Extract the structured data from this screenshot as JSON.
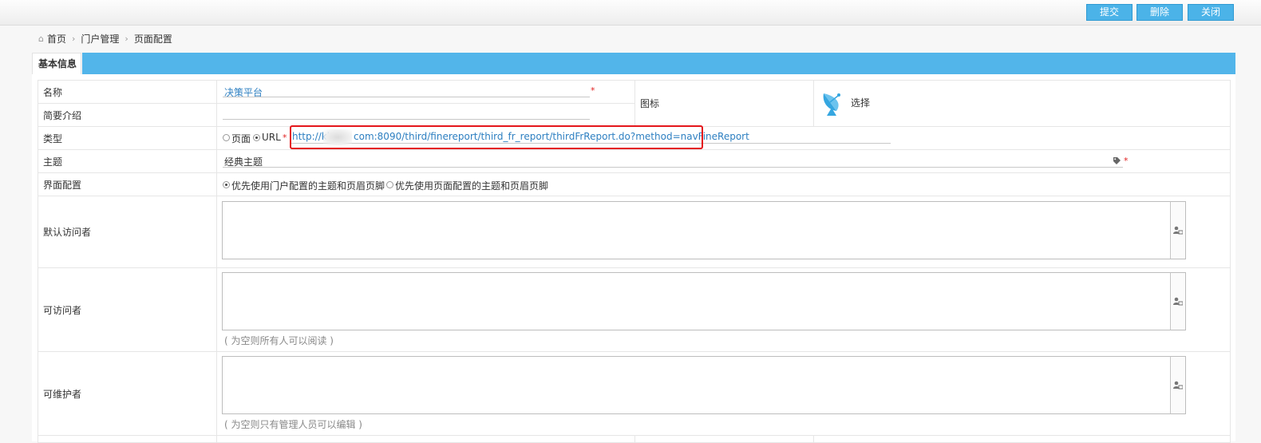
{
  "toolbar": {
    "submit_label": "提交",
    "delete_label": "删除",
    "close_label": "关闭"
  },
  "breadcrumb": {
    "home_icon": "home-icon",
    "items": [
      "首页",
      "门户管理",
      "页面配置"
    ],
    "separator": "›"
  },
  "section": {
    "title": "基本信息",
    "accent_color": "#52b5ea"
  },
  "form": {
    "name": {
      "label": "名称",
      "value": "决策平台"
    },
    "summary": {
      "label": "简要介绍",
      "value": ""
    },
    "icon": {
      "label": "图标",
      "select_label": "选择",
      "icon_name": "satellite-dish-icon"
    },
    "type": {
      "label": "类型",
      "options": [
        "页面",
        "URL"
      ],
      "selected": "URL",
      "url_prefix": "http://kk",
      "url_suffix": "com:8090/third/finereport/third_fr_report/thirdFrReport.do?method=navFineReport"
    },
    "theme": {
      "label": "主题",
      "value": "经典主题",
      "tag_icon": "tag-icon"
    },
    "ui_config": {
      "label": "界面配置",
      "options": [
        "优先使用门户配置的主题和页眉页脚",
        "优先使用页面配置的主题和页眉页脚"
      ],
      "selected": "优先使用门户配置的主题和页眉页脚"
    },
    "default_visitors": {
      "label": "默认访问者",
      "value": ""
    },
    "visitors": {
      "label": "可访问者",
      "value": "",
      "hint": "( 为空则所有人可以阅读 )"
    },
    "maintainers": {
      "label": "可维护者",
      "value": "",
      "hint": "( 为空则只有管理人员可以编辑 )"
    }
  },
  "required_mark": "*",
  "highlight_color": "#e4161b"
}
